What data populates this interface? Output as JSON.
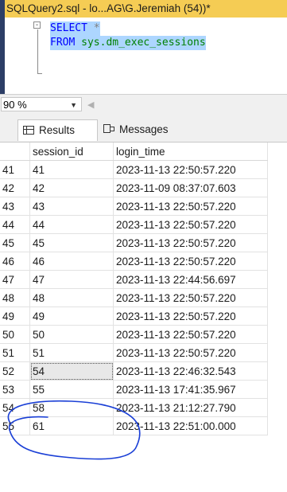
{
  "tab": {
    "title": "SQLQuery2.sql - lo...AG\\G.Jeremiah (54))*"
  },
  "editor": {
    "line1_keyword": "SELECT",
    "line1_rest": " *",
    "line2_keyword": "FROM",
    "line2_rest": " sys.dm_exec_sessions",
    "collapse_glyph": "-"
  },
  "zoom": {
    "value": "90 %"
  },
  "results_tabs": {
    "results_label": "Results",
    "messages_label": "Messages"
  },
  "grid": {
    "columns": [
      "",
      "session_id",
      "login_time"
    ],
    "rows": [
      [
        "41",
        "41",
        "2023-11-13 22:50:57.220"
      ],
      [
        "42",
        "42",
        "2023-11-09 08:37:07.603"
      ],
      [
        "43",
        "43",
        "2023-11-13 22:50:57.220"
      ],
      [
        "44",
        "44",
        "2023-11-13 22:50:57.220"
      ],
      [
        "45",
        "45",
        "2023-11-13 22:50:57.220"
      ],
      [
        "46",
        "46",
        "2023-11-13 22:50:57.220"
      ],
      [
        "47",
        "47",
        "2023-11-13 22:44:56.697"
      ],
      [
        "48",
        "48",
        "2023-11-13 22:50:57.220"
      ],
      [
        "49",
        "49",
        "2023-11-13 22:50:57.220"
      ],
      [
        "50",
        "50",
        "2023-11-13 22:50:57.220"
      ],
      [
        "51",
        "51",
        "2023-11-13 22:50:57.220"
      ],
      [
        "52",
        "54",
        "2023-11-13 22:46:32.543"
      ],
      [
        "53",
        "55",
        "2023-11-13 17:41:35.967"
      ],
      [
        "54",
        "58",
        "2023-11-13 21:12:27.790"
      ],
      [
        "55",
        "61",
        "2023-11-13 22:51:00.000"
      ]
    ],
    "selected_row_index": 11
  },
  "colors": {
    "tab_background": "#f5cc54",
    "selection_highlight": "#add6ff",
    "annotation_ink": "#1a3fd6",
    "keyword": "#0000ff",
    "system_object": "#008000"
  }
}
